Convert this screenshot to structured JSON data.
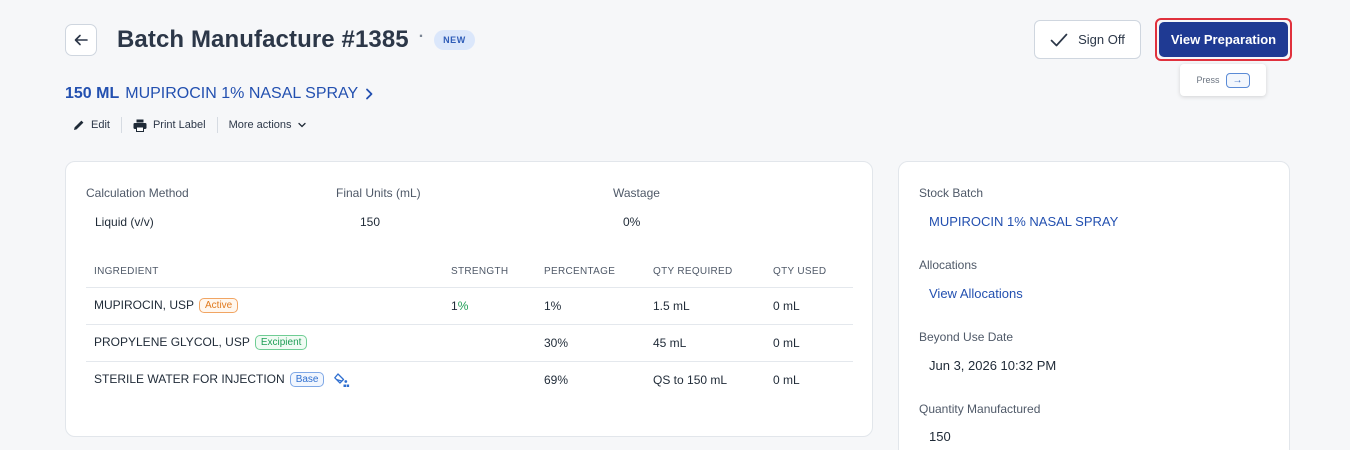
{
  "header": {
    "title": "Batch Manufacture #1385",
    "dot": "·",
    "status": "NEW"
  },
  "actions": {
    "sign_off": "Sign Off",
    "view_preparation": "View Preparation",
    "tooltip_press": "Press",
    "tooltip_key": "→"
  },
  "product": {
    "quantity": "150 ML",
    "name": "MUPIROCIN 1% NASAL SPRAY",
    "chevron": "›"
  },
  "toolbar": {
    "edit": "Edit",
    "print_label": "Print Label",
    "more_actions": "More actions"
  },
  "summary": {
    "calc_method_label": "Calculation Method",
    "calc_method_value": "Liquid (v/v)",
    "final_units_label": "Final Units (mL)",
    "final_units_value": "150",
    "wastage_label": "Wastage",
    "wastage_value": "0%"
  },
  "table": {
    "headers": [
      "INGREDIENT",
      "STRENGTH",
      "PERCENTAGE",
      "QTY REQUIRED",
      "QTY USED"
    ],
    "rows": [
      {
        "ingredient": "MUPIROCIN, USP",
        "tag": "Active",
        "strength_num": "1",
        "strength_unit": "%",
        "percentage": "1%",
        "qty_required": "1.5 mL",
        "qty_used": "0 mL"
      },
      {
        "ingredient": "PROPYLENE GLYCOL, USP",
        "tag": "Excipient",
        "strength_num": "",
        "strength_unit": "",
        "percentage": "30%",
        "qty_required": "45 mL",
        "qty_used": "0 mL"
      },
      {
        "ingredient": "STERILE WATER FOR INJECTION",
        "tag": "Base",
        "strength_num": "",
        "strength_unit": "",
        "percentage": "69%",
        "qty_required": "QS to 150 mL",
        "qty_used": "0 mL"
      }
    ]
  },
  "side": {
    "stock_batch_label": "Stock Batch",
    "stock_batch_value": "MUPIROCIN 1% NASAL SPRAY",
    "allocations_label": "Allocations",
    "allocations_value": "View Allocations",
    "bud_label": "Beyond Use Date",
    "bud_value": "Jun 3, 2026 10:32 PM",
    "qty_manufactured_label": "Quantity Manufactured",
    "qty_manufactured_value": "150"
  },
  "colors": {
    "primary": "#1f3a93",
    "link": "#2350b0",
    "highlight": "#e0313d",
    "active_tag": "#e07a1f",
    "excipient_tag": "#1f9e55",
    "base_tag": "#2f6fd0"
  },
  "icons": {
    "back": "arrow-left-icon",
    "sign_off": "check-icon",
    "edit": "pencil-icon",
    "print": "printer-icon",
    "more": "chevron-down-icon",
    "qs": "qs-fill-icon"
  }
}
